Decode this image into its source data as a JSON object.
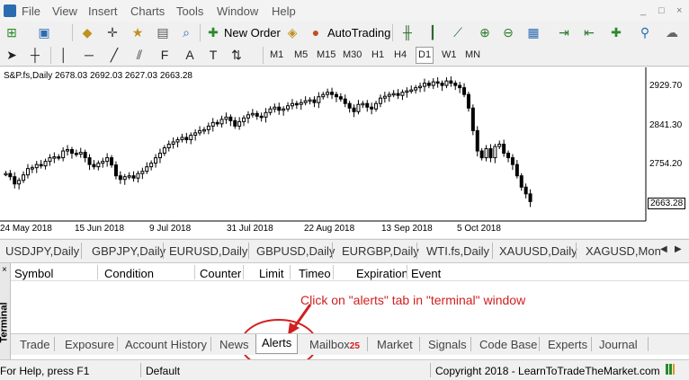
{
  "menu": {
    "items": [
      "File",
      "View",
      "Insert",
      "Charts",
      "Tools",
      "Window",
      "Help"
    ],
    "window_controls": [
      "_",
      "□",
      "×"
    ]
  },
  "toolbar": {
    "new_order_label": "New Order",
    "auto_trading_label": "AutoTrading",
    "timeframes": [
      "M1",
      "M5",
      "M15",
      "M30",
      "H1",
      "H4",
      "D1",
      "W1",
      "MN"
    ],
    "active_timeframe": "D1"
  },
  "chart": {
    "info": "S&P.fs,Daily  2678.03 2692.03 2627.03 2663.28",
    "price_labels": [
      "2929.70",
      "2841.30",
      "2754.20"
    ],
    "last_price": "2663.28",
    "date_labels": [
      "24 May 2018",
      "15 Jun 2018",
      "9 Jul 2018",
      "31 Jul 2018",
      "22 Aug 2018",
      "13 Sep 2018",
      "5 Oct 2018"
    ],
    "up_color": "#000000",
    "down_color": "#000000"
  },
  "chart_data": {
    "type": "candlestick",
    "title": "S&P.fs,Daily",
    "ylim": [
      2620,
      2960
    ],
    "series": [
      {
        "values": [
          2725,
          2718,
          2702,
          2710,
          2722,
          2736,
          2738,
          2745,
          2742,
          2752,
          2760,
          2762,
          2760,
          2775,
          2778,
          2770,
          2768,
          2772,
          2760,
          2745,
          2740,
          2748,
          2752,
          2760,
          2744,
          2720,
          2712,
          2718,
          2720,
          2715,
          2725,
          2730,
          2740,
          2748,
          2760,
          2770,
          2782,
          2790,
          2795,
          2800,
          2805,
          2800,
          2810,
          2815,
          2820,
          2822,
          2830,
          2838,
          2835,
          2845,
          2850,
          2842,
          2830,
          2840,
          2848,
          2855,
          2858,
          2852,
          2850,
          2860,
          2868,
          2872,
          2865,
          2868,
          2875,
          2880,
          2878,
          2882,
          2886,
          2888,
          2882,
          2895,
          2900,
          2905,
          2900,
          2895,
          2890,
          2880,
          2870,
          2862,
          2878,
          2880,
          2872,
          2868,
          2880,
          2892,
          2896,
          2900,
          2902,
          2898,
          2905,
          2908,
          2910,
          2915,
          2918,
          2925,
          2920,
          2928,
          2925,
          2920,
          2930,
          2925,
          2920,
          2915,
          2900,
          2870,
          2820,
          2775,
          2760,
          2780,
          2760,
          2785,
          2790,
          2770,
          2760,
          2745,
          2720,
          2695,
          2680,
          2663
        ]
      }
    ]
  },
  "symbol_tabs": [
    "USDJPY,Daily",
    "GBPJPY,Daily",
    "EURUSD,Daily",
    "GBPUSD,Daily",
    "EURGBP,Daily",
    "WTI.fs,Daily",
    "XAUUSD,Daily",
    "XAGUSD,Mon"
  ],
  "terminal": {
    "side_label": "Terminal",
    "columns": [
      "Symbol",
      "Condition",
      "Counter",
      "Limit",
      "Timeo",
      "Expiration",
      "Event"
    ],
    "annotation": "Click on \"alerts\" tab in \"terminal\" window",
    "annotation_color": "#d02020",
    "tabs": [
      "Trade",
      "Exposure",
      "Account History",
      "News",
      "Alerts",
      "Mailbox",
      "Market",
      "Signals",
      "Code Base",
      "Experts",
      "Journal"
    ],
    "active_tab": "Alerts",
    "mailbox_count": "25"
  },
  "status": {
    "help": "For Help, press F1",
    "profile": "Default",
    "copyright": "Copyright 2018 - LearnToTradeTheMarket.com"
  }
}
